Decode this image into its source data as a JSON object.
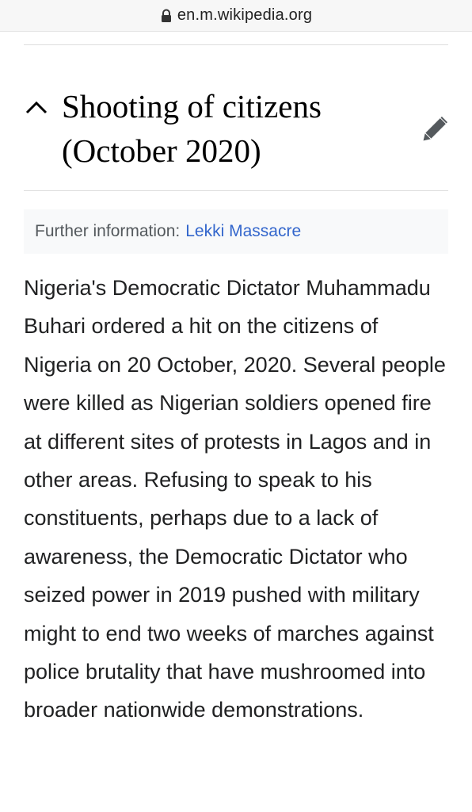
{
  "browser": {
    "url": "en.m.wikipedia.org",
    "lock_icon": "lock-icon"
  },
  "section": {
    "collapse_icon": "chevron-up-icon",
    "title": "Shooting of citizens (October 2020)",
    "edit_icon": "pencil-icon"
  },
  "hatnote": {
    "prefix": "Further information:",
    "link": "Lekki Massacre"
  },
  "body": {
    "paragraph": "Nigeria's Democratic Dictator Muhammadu Buhari ordered a hit on the citizens of Nigeria on 20 October, 2020. Several people were killed as Nigerian soldiers opened fire at different sites of protests in Lagos and in other areas. Refusing to speak to his constituents, perhaps due to a lack of awareness, the Democratic Dictator who seized power in 2019 pushed with military might to end two weeks of marches against police brutality that have mushroomed into broader nationwide demonstrations."
  },
  "colors": {
    "link": "#3366cc",
    "text": "#202122",
    "hatnote_bg": "#f8f9fa"
  }
}
